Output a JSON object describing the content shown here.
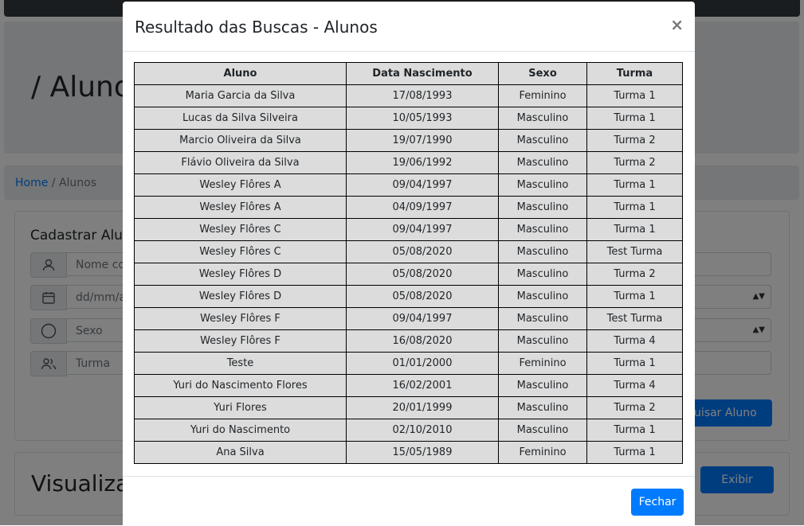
{
  "page": {
    "title": "/ Alunos",
    "breadcrumb": {
      "home": "Home",
      "separator": "/",
      "current": "Alunos"
    },
    "form": {
      "title": "Cadastrar Alunos",
      "fields": {
        "name_placeholder": "Nome completo",
        "date_placeholder": "dd/mm/aaaa",
        "sex_selected": "Sexo",
        "class_value": "Turma"
      },
      "search_button": "Pesquisar Aluno"
    },
    "view": {
      "title": "Visualizar Alunos",
      "button": "Exibir"
    }
  },
  "modal": {
    "title": "Resultado das Buscas - Alunos",
    "close_symbol": "×",
    "close_button": "Fechar",
    "table": {
      "headers": [
        "Aluno",
        "Data Nascimento",
        "Sexo",
        "Turma"
      ],
      "rows": [
        [
          "Maria Garcia da Silva",
          "17/08/1993",
          "Feminino",
          "Turma 1"
        ],
        [
          "Lucas da Silva Silveira",
          "10/05/1993",
          "Masculino",
          "Turma 1"
        ],
        [
          "Marcio Oliveira da Silva",
          "19/07/1990",
          "Masculino",
          "Turma 2"
        ],
        [
          "Flávio Oliveira da Silva",
          "19/06/1992",
          "Masculino",
          "Turma 2"
        ],
        [
          "Wesley Flôres A",
          "09/04/1997",
          "Masculino",
          "Turma 1"
        ],
        [
          "Wesley Flôres A",
          "04/09/1997",
          "Masculino",
          "Turma 1"
        ],
        [
          "Wesley Flôres C",
          "09/04/1997",
          "Masculino",
          "Turma 1"
        ],
        [
          "Wesley Flôres C",
          "05/08/2020",
          "Masculino",
          "Test Turma"
        ],
        [
          "Wesley Flôres D",
          "05/08/2020",
          "Masculino",
          "Turma 2"
        ],
        [
          "Wesley Flôres D",
          "05/08/2020",
          "Masculino",
          "Turma 1"
        ],
        [
          "Wesley Flôres F",
          "09/04/1997",
          "Masculino",
          "Test Turma"
        ],
        [
          "Wesley Flôres F",
          "16/08/2020",
          "Masculino",
          "Turma 4"
        ],
        [
          "Teste",
          "01/01/2000",
          "Feminino",
          "Turma 1"
        ],
        [
          "Yuri do Nascimento Flores",
          "16/02/2001",
          "Masculino",
          "Turma 4"
        ],
        [
          "Yuri Flores",
          "20/01/1999",
          "Masculino",
          "Turma 2"
        ],
        [
          "Yuri do Nascimento",
          "02/10/2010",
          "Masculino",
          "Turma 1"
        ],
        [
          "Ana Silva",
          "15/05/1989",
          "Feminino",
          "Turma 1"
        ]
      ]
    }
  },
  "icons": [
    "user-icon",
    "calendar-icon",
    "circle-icon",
    "users-icon",
    "close-icon"
  ],
  "colors": {
    "primary": "#007bff",
    "navbar": "#343a40",
    "table_bg": "#dcdcdc",
    "backdrop": "rgba(0,0,0,0.5)"
  }
}
